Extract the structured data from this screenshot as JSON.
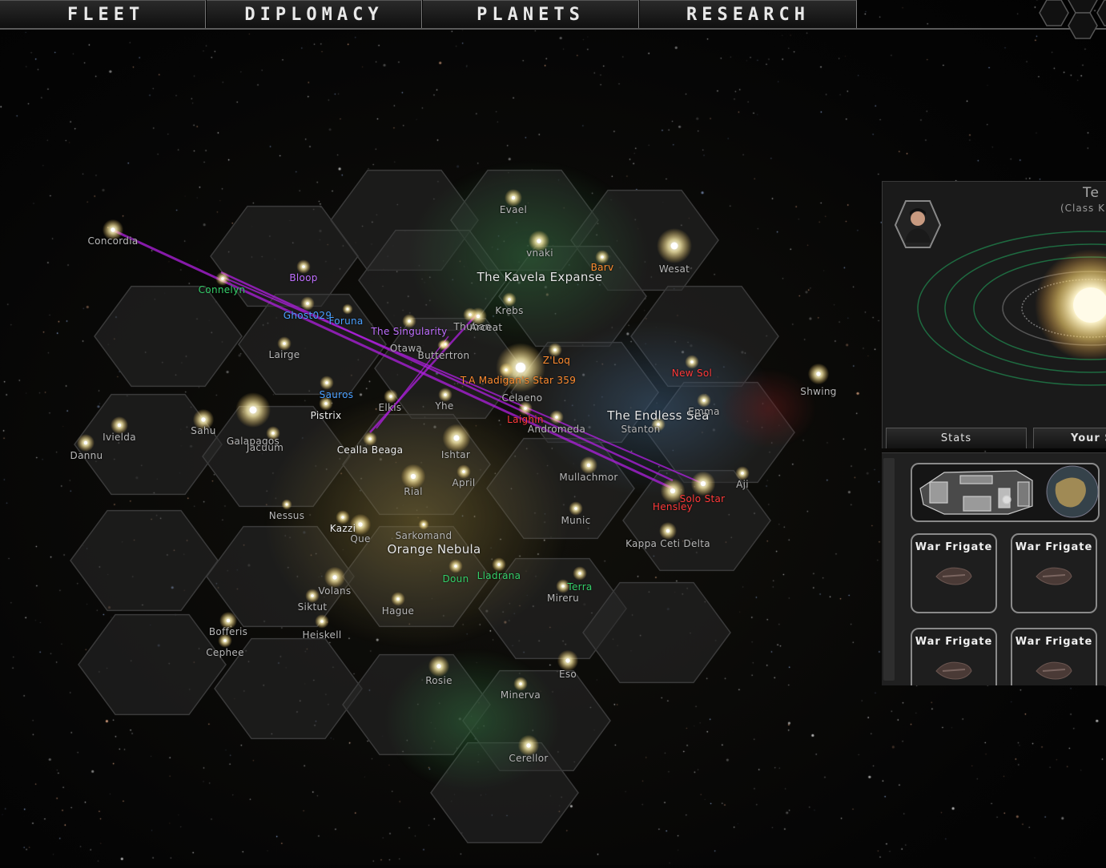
{
  "nav": {
    "tabs": [
      {
        "label": "FLEET"
      },
      {
        "label": "DIPLOMACY"
      },
      {
        "label": "PLANETS"
      },
      {
        "label": "RESEARCH"
      }
    ]
  },
  "map": {
    "regions": [
      {
        "name": "The Kavela Expanse"
      },
      {
        "name": "The Endless Sea"
      },
      {
        "name": "Orange Nebula"
      }
    ],
    "systems": [
      {
        "name": "Evael",
        "color": "gray"
      },
      {
        "name": "vnaki",
        "color": "gray"
      },
      {
        "name": "Barv",
        "color": "orange"
      },
      {
        "name": "Wesat",
        "color": "gray"
      },
      {
        "name": "Concordia",
        "color": "gray"
      },
      {
        "name": "Bloop",
        "color": "purple"
      },
      {
        "name": "Connelyn",
        "color": "green"
      },
      {
        "name": "Krebs",
        "color": "gray"
      },
      {
        "name": "Ghost029",
        "color": "blue"
      },
      {
        "name": "Foruna",
        "color": "blue"
      },
      {
        "name": "The Singularity",
        "color": "purple"
      },
      {
        "name": "Thuban",
        "color": "gray"
      },
      {
        "name": "Arceat",
        "color": "gray"
      },
      {
        "name": "Otawa",
        "color": "gray"
      },
      {
        "name": "Lairge",
        "color": "gray"
      },
      {
        "name": "Buttertron",
        "color": "gray"
      },
      {
        "name": "Z'Loq",
        "color": "orange"
      },
      {
        "name": "New Sol",
        "color": "red"
      },
      {
        "name": "T.A Madigan's Star 359",
        "color": "orange"
      },
      {
        "name": "Shwing",
        "color": "gray"
      },
      {
        "name": "Sauros",
        "color": "blue"
      },
      {
        "name": "Celaeno",
        "color": "gray"
      },
      {
        "name": "Pistrix",
        "color": "white"
      },
      {
        "name": "Elkis",
        "color": "gray"
      },
      {
        "name": "Yhe",
        "color": "gray"
      },
      {
        "name": "Emma",
        "color": "gray"
      },
      {
        "name": "Laighin",
        "color": "red"
      },
      {
        "name": "Sahu",
        "color": "gray"
      },
      {
        "name": "Ivielda",
        "color": "gray"
      },
      {
        "name": "Andromeda",
        "color": "gray"
      },
      {
        "name": "Stanton",
        "color": "gray"
      },
      {
        "name": "Galapagos",
        "color": "gray"
      },
      {
        "name": "Jacuum",
        "color": "gray"
      },
      {
        "name": "Dannu",
        "color": "gray"
      },
      {
        "name": "Cealla Beaga",
        "color": "white"
      },
      {
        "name": "Ishtar",
        "color": "gray"
      },
      {
        "name": "Mullachmor",
        "color": "gray"
      },
      {
        "name": "Aji",
        "color": "gray"
      },
      {
        "name": "April",
        "color": "gray"
      },
      {
        "name": "Solo Star",
        "color": "red"
      },
      {
        "name": "Hensley",
        "color": "red"
      },
      {
        "name": "Rial",
        "color": "gray"
      },
      {
        "name": "Nessus",
        "color": "gray"
      },
      {
        "name": "Munic",
        "color": "gray"
      },
      {
        "name": "Kazzi",
        "color": "white"
      },
      {
        "name": "Que",
        "color": "gray"
      },
      {
        "name": "Sarkomand",
        "color": "gray"
      },
      {
        "name": "Kappa Ceti Delta",
        "color": "gray"
      },
      {
        "name": "Doun",
        "color": "green"
      },
      {
        "name": "Lladrana",
        "color": "green"
      },
      {
        "name": "Terra",
        "color": "green"
      },
      {
        "name": "Volans",
        "color": "gray"
      },
      {
        "name": "Mireru",
        "color": "gray"
      },
      {
        "name": "Siktut",
        "color": "gray"
      },
      {
        "name": "Hague",
        "color": "gray"
      },
      {
        "name": "Bofferis",
        "color": "gray"
      },
      {
        "name": "Heiskell",
        "color": "gray"
      },
      {
        "name": "Cephee",
        "color": "gray"
      },
      {
        "name": "Rosie",
        "color": "gray"
      },
      {
        "name": "Eso",
        "color": "gray"
      },
      {
        "name": "Minerva",
        "color": "gray"
      },
      {
        "name": "Cerellor",
        "color": "gray"
      }
    ]
  },
  "system_panel": {
    "title": "Te",
    "subtitle": "(Class K",
    "tabs": [
      {
        "label": "Stats"
      },
      {
        "label": "Your S"
      }
    ]
  },
  "fleet_panel": {
    "ships": [
      {
        "label": "War Frigate"
      },
      {
        "label": "War Frigate"
      },
      {
        "label": "War Frigate"
      },
      {
        "label": "War Frigate"
      }
    ]
  },
  "colors": {
    "green": "#35d06a",
    "blue": "#4aa0ff",
    "purple": "#c070ff",
    "orange": "#ff8c30",
    "red": "#ff3a3a",
    "white": "#f0f0f0",
    "gray": "#b8b8b8",
    "hyperlane": "#b020e0"
  }
}
